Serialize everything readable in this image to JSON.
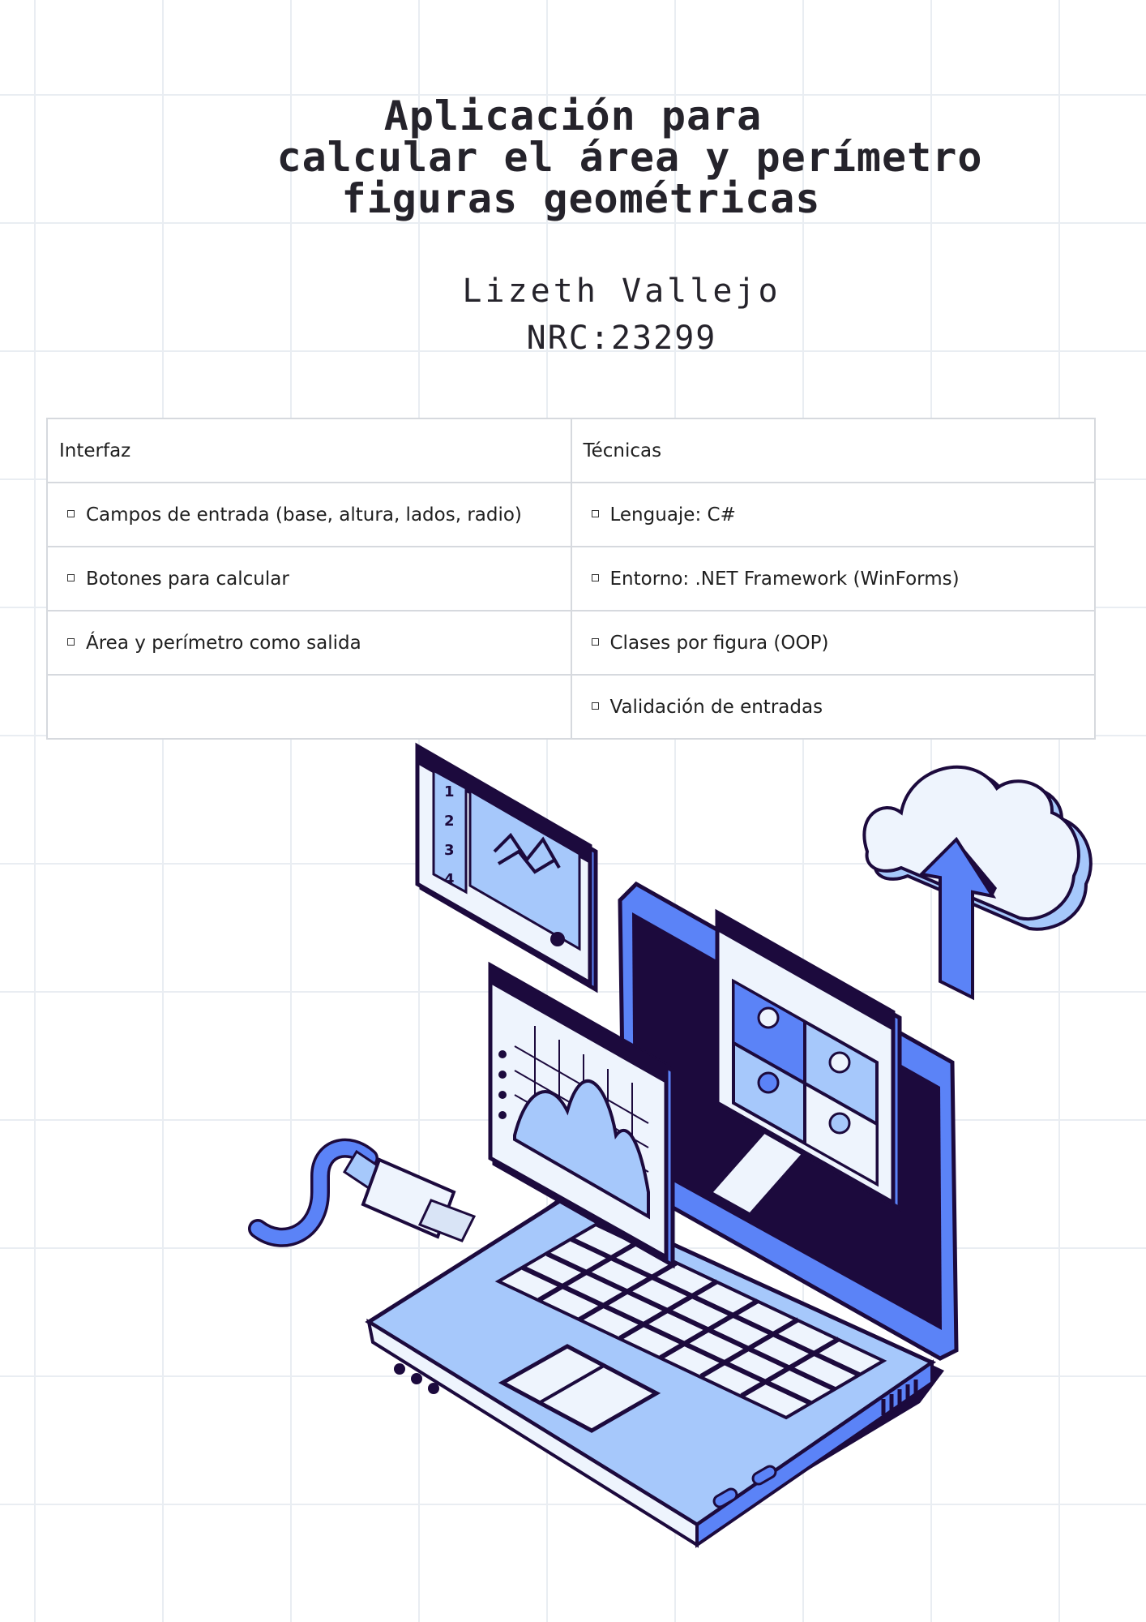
{
  "title": {
    "line1": "Aplicación para",
    "line2": "calcular el área y perímetro",
    "line3": "figuras geométricas"
  },
  "author": "Lizeth Vallejo",
  "nrc": "NRC:23299",
  "table": {
    "headers": [
      "Interfaz",
      "Técnicas"
    ],
    "rows": [
      [
        "Campos de entrada (base, altura, lados, radio)",
        "Lenguaje: C#"
      ],
      [
        "Botones para calcular",
        "Entorno: .NET Framework (WinForms)"
      ],
      [
        "Área y perímetro como salida",
        "Clases por figura (OOP)"
      ],
      [
        "",
        "Validación de entradas"
      ]
    ]
  },
  "colors": {
    "accent": "#5b83f7",
    "light_blue": "#a6c8fb",
    "pale_blue": "#eef4fd",
    "dark": "#1c0a3d"
  },
  "illustration": {
    "panel_numbers": [
      "1",
      "2",
      "3",
      "4"
    ],
    "icons": [
      "laptop-icon",
      "cloud-upload-icon",
      "usb-cable-icon"
    ]
  }
}
